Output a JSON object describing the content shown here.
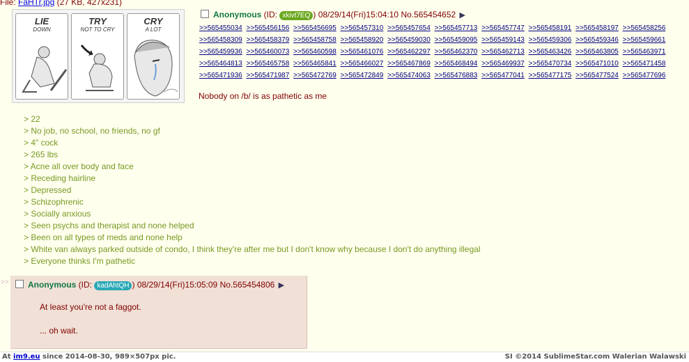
{
  "file_info": {
    "prefix": "File: ",
    "filename": "FaHTr.jpg",
    "details": " (27 KB, 427x231)"
  },
  "thumbnail": {
    "panels": [
      {
        "title": "LIE",
        "subtitle": "DOWN"
      },
      {
        "title": "TRY",
        "subtitle": "NOT TO CRY"
      },
      {
        "title": "CRY",
        "subtitle": "A LOT"
      }
    ]
  },
  "op": {
    "name": "Anonymous",
    "id_prefix": " (ID: ",
    "id": "xkivt7EQ",
    "id_suffix": ")",
    "datetime": " 08/29/14(Fri)15:04:10",
    "number": " No.565454652",
    "arrow": "▶",
    "backlinks": [
      ">>565455034",
      ">>565456156",
      ">>565456695",
      ">>565457310",
      ">>565457654",
      ">>565457713",
      ">>565457747",
      ">>565458191",
      ">>565458197",
      ">>565458256",
      ">>565458309",
      ">>565458379",
      ">>565458758",
      ">>565458920",
      ">>565459030",
      ">>565459095",
      ">>565459143",
      ">>565459306",
      ">>565459346",
      ">>565459661",
      ">>565459936",
      ">>565460073",
      ">>565460598",
      ">>565461076",
      ">>565462297",
      ">>565462370",
      ">>565462713",
      ">>565463426",
      ">>565463805",
      ">>565463971",
      ">>565464813",
      ">>565465758",
      ">>565465841",
      ">>565466027",
      ">>565467869",
      ">>565468494",
      ">>565469937",
      ">>565470734",
      ">>565471010",
      ">>565471458",
      ">>565471936",
      ">>565471987",
      ">>565472769",
      ">>565472849",
      ">>565474063",
      ">>565476883",
      ">>565477041",
      ">>565477175",
      ">>565477524",
      ">>565477696"
    ],
    "message": "Nobody on /b/ is as pathetic as me",
    "greentext": [
      "> 22",
      "> No job, no school, no friends, no gf",
      "> 4\" cock",
      "> 265 lbs",
      "> Acne all over body and face",
      "> Receding hairline",
      "> Depressed",
      "> Schizophrenic",
      "> Socially anxious",
      "> Seen psychs and therapist and none helped",
      "> Been on all types of meds and none help",
      "> White van always parked outside of condo, I think they're after me but I don't know why because I don't do anything illegal",
      "> Everyone thinks I'm pathetic"
    ]
  },
  "reply": {
    "separator": ">>",
    "name": "Anonymous",
    "id_prefix": " (ID: ",
    "id": "kadAhtQH",
    "id_suffix": ")",
    "datetime": " 08/29/14(Fri)15:05:09",
    "number": " No.565454806",
    "arrow": "▶",
    "line1": "At least you're not a faggot.",
    "line2": "... oh wait."
  },
  "footer": {
    "left_prefix": "At ",
    "site": "im9.eu",
    "left_suffix": " since 2014-08-30, 989×507px pic.",
    "right": "SI ©2014 SublimeStar.com Walerian Walawski"
  },
  "colors": {
    "background": "#ffffee",
    "name_green": "#117743",
    "greentext": "#789922",
    "reply_bg": "#f0e0d6",
    "id_op": "#6aa81e",
    "id_reply": "#2aa8b6"
  }
}
